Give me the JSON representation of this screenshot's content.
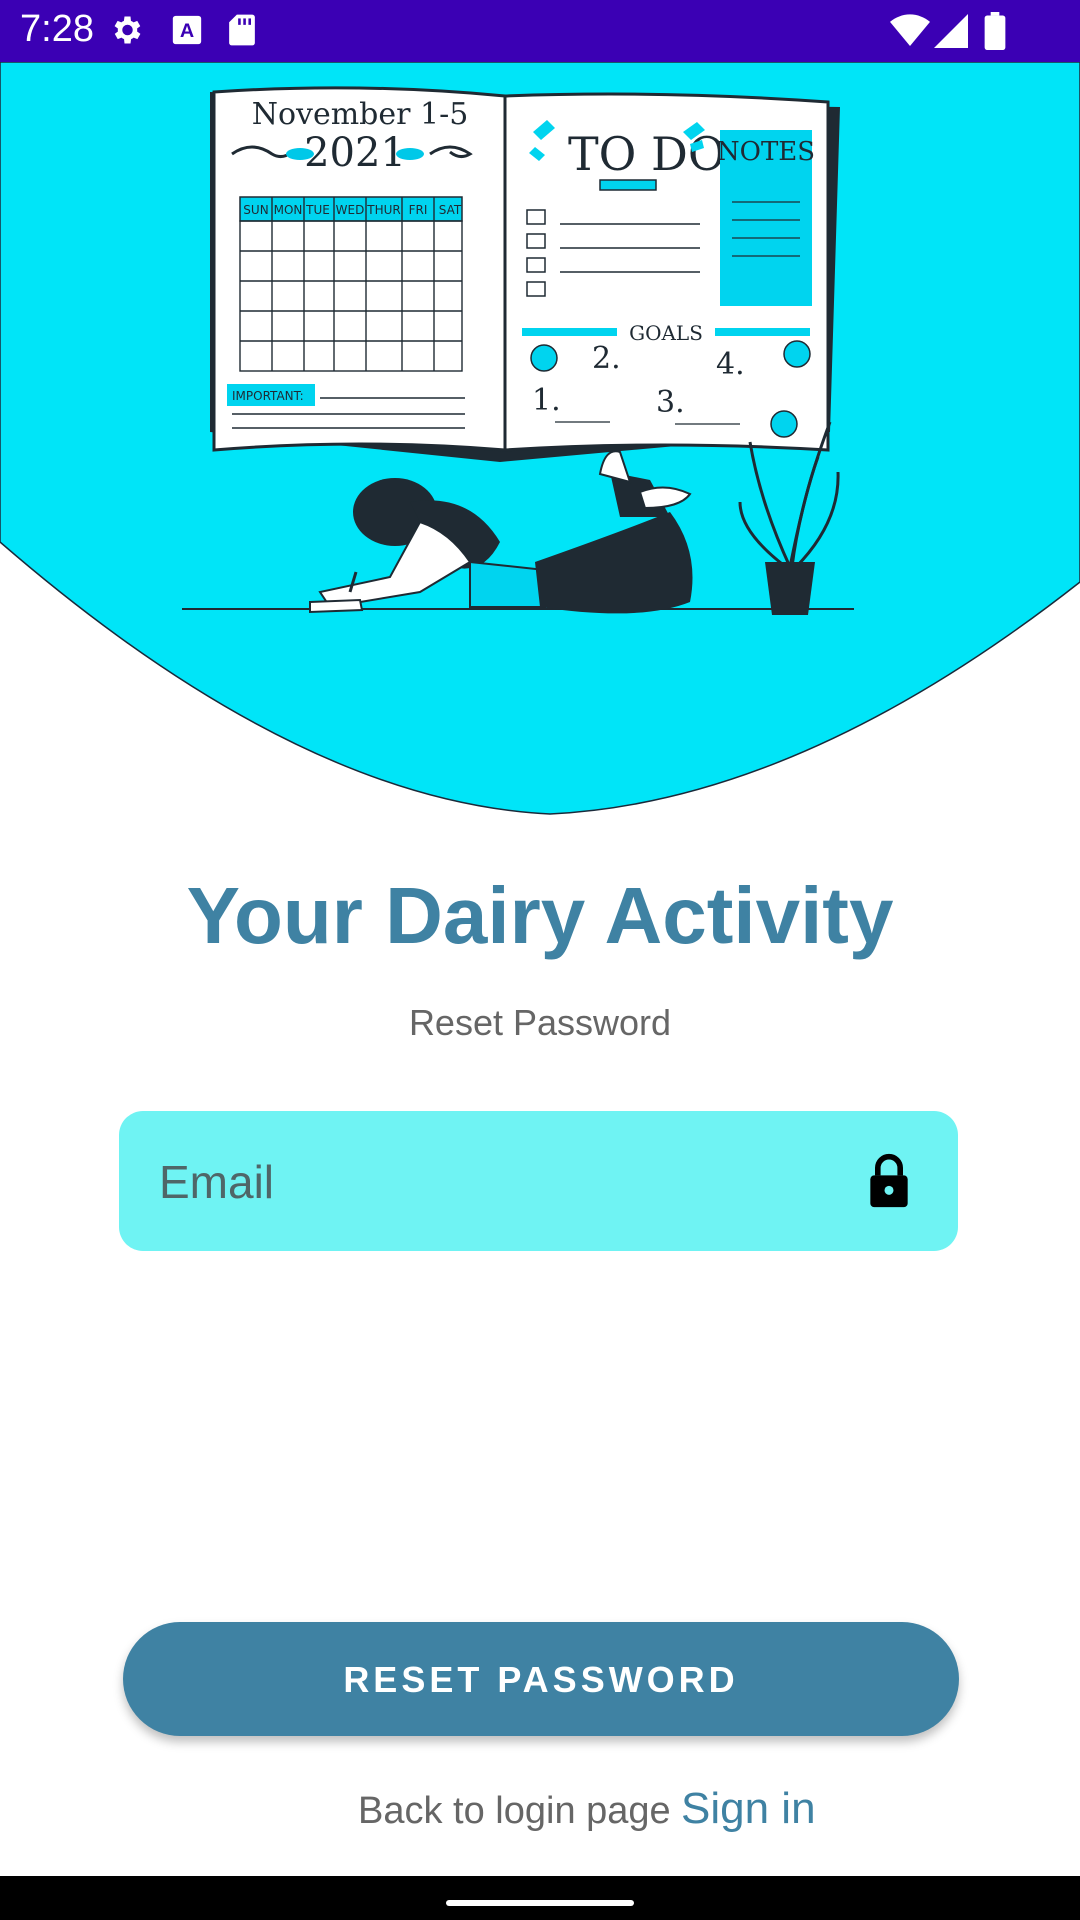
{
  "status_bar": {
    "time": "7:28",
    "left_icons": [
      "gear-icon",
      "a-icon",
      "sd-card-icon"
    ],
    "right_icons": [
      "wifi-icon",
      "signal-icon",
      "battery-icon"
    ],
    "color": "#3b00b4"
  },
  "hero": {
    "calendar_title": "November 1-5",
    "calendar_year": "2021",
    "weekdays": [
      "SUN",
      "MON",
      "TUE",
      "WED",
      "THUR",
      "FRI",
      "SAT"
    ],
    "important_label": "IMPORTANT:",
    "todo_title": "TO DO:",
    "notes_title": "NOTES",
    "goals_title": "GOALS",
    "goal_numbers": [
      "1.",
      "2.",
      "3.",
      "4."
    ],
    "accent_color": "#00e5f8"
  },
  "title": "Your Dairy Activity",
  "subtitle": "Reset Password",
  "email_field": {
    "placeholder": "Email",
    "value": "",
    "icon": "lock-icon"
  },
  "reset_button": {
    "label": "RESET PASSWORD"
  },
  "footer": {
    "back_text": "Back to login page",
    "signin_label": "Sign in"
  },
  "colors": {
    "primary": "#3f82a3",
    "field_bg": "#6ff3f3",
    "hero_bg": "#00e5f8"
  }
}
